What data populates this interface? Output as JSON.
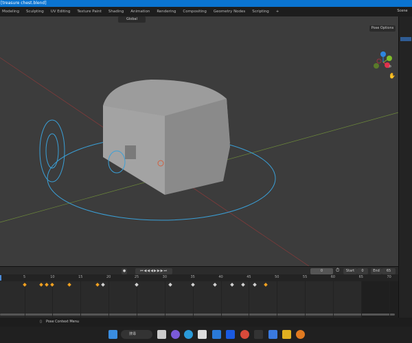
{
  "window": {
    "title": "[treasure chest.blend]"
  },
  "workspace_tabs": [
    "Modeling",
    "Sculpting",
    "UV Editing",
    "Texture Paint",
    "Shading",
    "Animation",
    "Rendering",
    "Compositing",
    "Geometry Nodes",
    "Scripting",
    "+"
  ],
  "header": {
    "transform_orientation": "Global",
    "scene": "Scene",
    "pose_options": "Pose Options"
  },
  "timeline": {
    "current_frame": "0",
    "start_label": "Start",
    "start": "0",
    "end_label": "End",
    "end": "65",
    "ticks": [
      "5",
      "10",
      "15",
      "20",
      "25",
      "30",
      "35",
      "40",
      "45",
      "50",
      "55",
      "60",
      "65",
      "70"
    ],
    "keyframes_selected": [
      5,
      8,
      9,
      10,
      13,
      18,
      48
    ],
    "keyframes": [
      19,
      25,
      31,
      35,
      39,
      42,
      44,
      46
    ]
  },
  "status": {
    "hint": "Pose Context Menu"
  },
  "taskbar": {
    "search": "搜尋"
  },
  "colors": {
    "accent": "#0a74d1",
    "keyframe_selected": "#f0a020",
    "keyframe": "#d0d0d0",
    "gizmo_x": "#e0324b",
    "gizmo_y": "#7fbd2a",
    "gizmo_z": "#2e85e0"
  }
}
